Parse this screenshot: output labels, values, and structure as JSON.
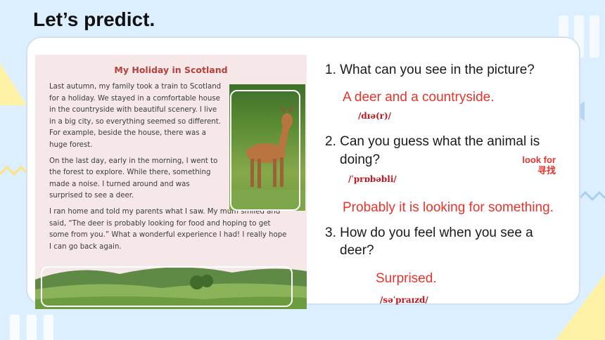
{
  "page": {
    "title": "Let’s predict."
  },
  "excerpt": {
    "title": "My Holiday in Scotland",
    "paragraphs": [
      "Last autumn, my family took a train to Scotland for a holiday. We stayed in a comfortable house in the countryside with beautiful scenery. I live in a big city, so everything seemed so different. For example, beside the house, there was a huge forest.",
      "On the last day, early in the morning, I went to the forest to explore. While there, something made a noise. I turned around and was surprised to see a deer.",
      "I ran home and told my parents what I saw. My mum smiled and said, “The deer is probably looking for food and hoping to get some from you.” What a wonderful experience I had! I really hope I can go back again."
    ]
  },
  "questions": [
    {
      "text": "1. What can you see in the picture?",
      "answer": "A deer and a countryside.",
      "phonetic": "/dɪə(r)/"
    },
    {
      "text_line1": "2. Can you guess what the animal is",
      "text_line2": "doing?",
      "answer": "Probably it is looking for something.",
      "phonetic": "/ˈprɒbəbli/",
      "note": "look for",
      "note_cn": "寻找"
    },
    {
      "text_line1": "3. How do you feel when you see a",
      "text_line2": "deer?",
      "answer": "Surprised.",
      "phonetic": "/səˈpraɪzd/"
    }
  ],
  "colors": {
    "answer": "#e8332b",
    "background": "#dcefff",
    "accent_yellow": "#fff2b0",
    "accent_blue": "#a9cfee"
  }
}
